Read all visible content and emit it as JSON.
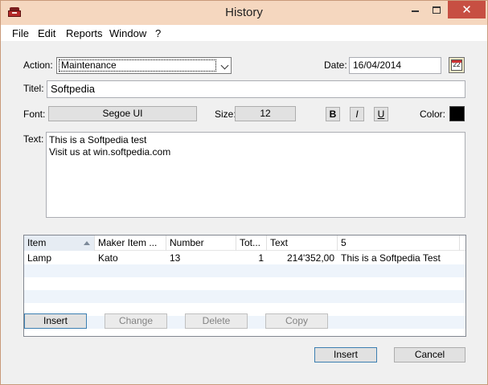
{
  "window": {
    "title": "History",
    "close_glyph": "✕"
  },
  "menu": [
    "File",
    "Edit",
    "Reports",
    "Window",
    "?"
  ],
  "form": {
    "action_label": "Action:",
    "action_value": "Maintenance",
    "date_label": "Date:",
    "date_value": "16/04/2014",
    "calendar_day": "22",
    "title_label": "Titel:",
    "title_value": "Softpedia",
    "font_label": "Font:",
    "font_value": "Segoe UI",
    "size_label": "Size:",
    "size_value": "12",
    "bold": "B",
    "italic": "I",
    "underline": "U",
    "color_label": "Color:",
    "color_value": "#000000",
    "text_label": "Text:",
    "text_lines": [
      "This is a Softpedia test",
      "Visit us at win.softpedia.com"
    ]
  },
  "grid": {
    "columns": [
      "Item",
      "Maker Item ...",
      "Number",
      "Tot...",
      "Text",
      "5"
    ],
    "rows": [
      [
        "Lamp",
        "Kato",
        "13",
        "1",
        "214'352,00",
        "This is a Softpedia Test"
      ]
    ]
  },
  "buttons": {
    "insert_row": "Insert",
    "change": "Change",
    "delete": "Delete",
    "copy": "Copy",
    "insert": "Insert",
    "cancel": "Cancel"
  },
  "colors": {
    "titlebar": "#f5d7bf",
    "close": "#c74f42"
  }
}
